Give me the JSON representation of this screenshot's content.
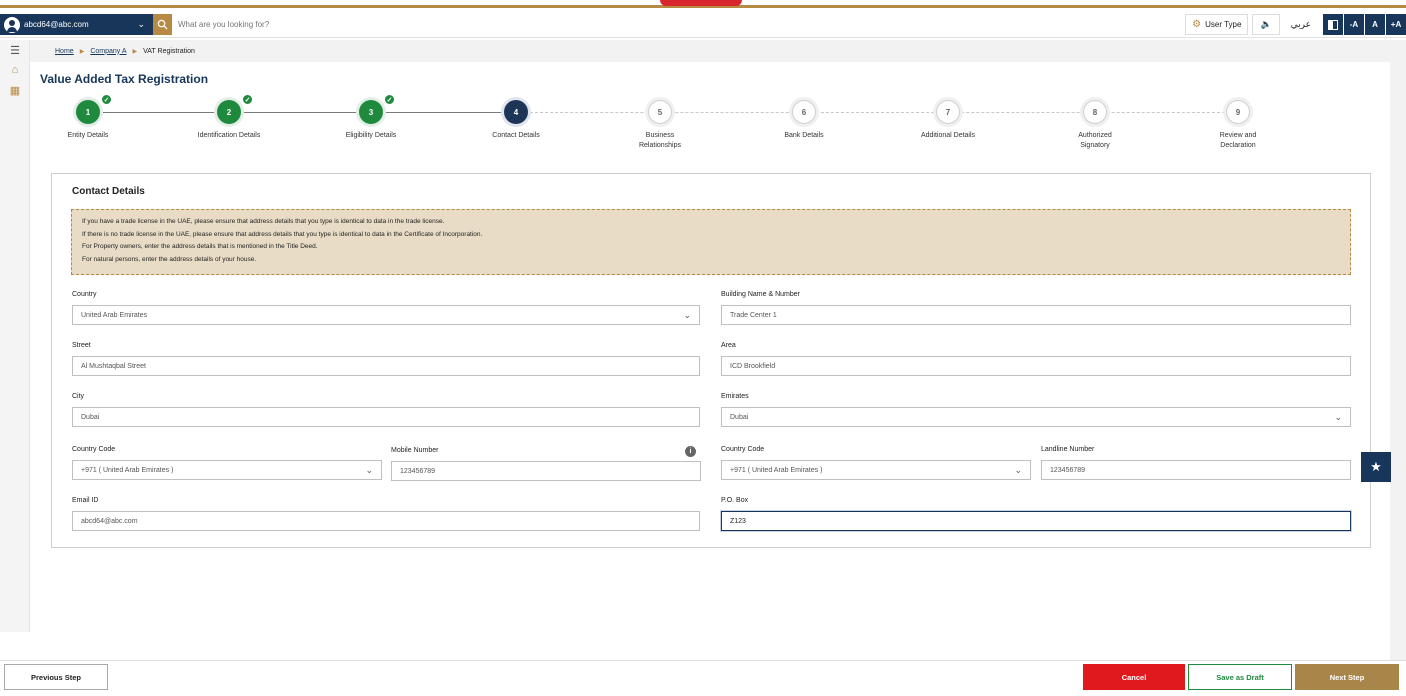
{
  "header": {
    "user_email": "abcd64@abc.com",
    "search_placeholder": "What are you looking for?",
    "user_type_label": "User Type",
    "language_label": "عربي",
    "font_small": "-A",
    "font_normal": "A",
    "font_large": "+A",
    "brand_color": "#b68a45",
    "navy_color": "#17365a"
  },
  "breadcrumb": {
    "home": "Home",
    "company": "Company A",
    "current": "VAT Registration"
  },
  "page_title": "Value Added Tax Registration",
  "stepper": {
    "steps": [
      {
        "number": "1",
        "label": "Entity Details",
        "state": "done"
      },
      {
        "number": "2",
        "label": "Identification Details",
        "state": "done"
      },
      {
        "number": "3",
        "label": "Eligibility Details",
        "state": "done"
      },
      {
        "number": "4",
        "label": "Contact Details",
        "state": "current"
      },
      {
        "number": "5",
        "label": "Business Relationships",
        "state": "todo"
      },
      {
        "number": "6",
        "label": "Bank Details",
        "state": "todo"
      },
      {
        "number": "7",
        "label": "Additional Details",
        "state": "todo"
      },
      {
        "number": "8",
        "label": "Authorized Signatory",
        "state": "todo"
      },
      {
        "number": "9",
        "label": "Review and Declaration",
        "state": "todo"
      }
    ],
    "check_glyph": "✓"
  },
  "contact": {
    "title": "Contact Details",
    "notice": [
      "If you have a trade license in the UAE, please ensure that address details that you type is identical to data in the trade license.",
      "If there is no trade license in the UAE, please ensure that address details that you type is identical to data in the Certificate of Incorporation.",
      "For Property owners, enter the address details that is mentioned in the Title Deed.",
      "For natural persons, enter the address details of your house."
    ],
    "fields": {
      "country": {
        "label": "Country",
        "value": "United Arab Emirates"
      },
      "building": {
        "label": "Building Name & Number",
        "value": "Trade Center 1"
      },
      "street": {
        "label": "Street",
        "value": "Al Mushtaqbal Street"
      },
      "area": {
        "label": "Area",
        "value": "ICD Brookfield"
      },
      "city": {
        "label": "City",
        "value": "Dubai"
      },
      "emirates": {
        "label": "Emirates",
        "value": "Dubai"
      },
      "mobile_country_code": {
        "label": "Country Code",
        "value": "+971 ( United Arab Emirates )"
      },
      "mobile_number": {
        "label": "Mobile Number",
        "value": "123456789"
      },
      "landline_country_code": {
        "label": "Country Code",
        "value": "+971 ( United Arab Emirates )"
      },
      "landline_number": {
        "label": "Landline Number",
        "value": "123456789"
      },
      "email": {
        "label": "Email ID",
        "value": "abcd64@abc.com"
      },
      "po_box": {
        "label": "P.O. Box",
        "value": "Z123"
      }
    }
  },
  "footer": {
    "previous": "Previous Step",
    "cancel": "Cancel",
    "save_draft": "Save as Draft",
    "next": "Next Step"
  }
}
